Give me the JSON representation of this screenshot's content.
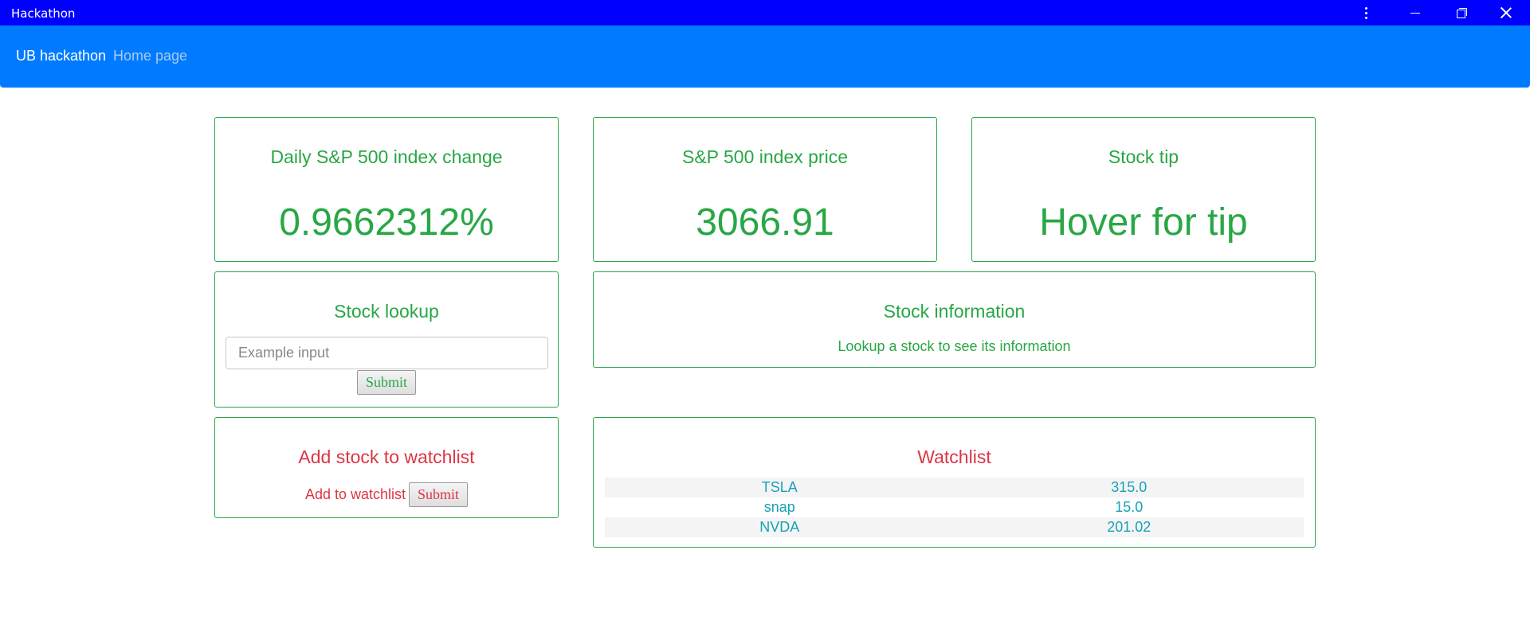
{
  "window": {
    "title": "Hackathon"
  },
  "navbar": {
    "brand": "UB hackathon",
    "home_link": "Home page"
  },
  "cards": {
    "daily_change": {
      "title": "Daily S&P 500 index change",
      "value": "0.9662312%"
    },
    "index_price": {
      "title": "S&P 500 index price",
      "value": "3066.91"
    },
    "stock_tip": {
      "title": "Stock tip",
      "value": "Hover for tip"
    },
    "stock_lookup": {
      "title": "Stock lookup",
      "input_placeholder": "Example input",
      "submit_label": "Submit"
    },
    "stock_info": {
      "title": "Stock information",
      "message": "Lookup a stock to see its information"
    },
    "add_watchlist": {
      "title": "Add stock to watchlist",
      "label": "Add to watchlist",
      "submit_label": "Submit"
    },
    "watchlist": {
      "title": "Watchlist",
      "rows": [
        {
          "symbol": "TSLA",
          "price": "315.0"
        },
        {
          "symbol": "snap",
          "price": "15.0"
        },
        {
          "symbol": "NVDA",
          "price": "201.02"
        }
      ]
    }
  },
  "colors": {
    "titlebar": "#0000ff",
    "navbar": "#007bff",
    "success": "#28a745",
    "danger": "#dc3545",
    "info": "#17a2b8"
  },
  "icons": {
    "more": "more-vertical-icon",
    "minimize": "minimize-icon",
    "maximize": "restore-icon",
    "close": "close-icon"
  }
}
